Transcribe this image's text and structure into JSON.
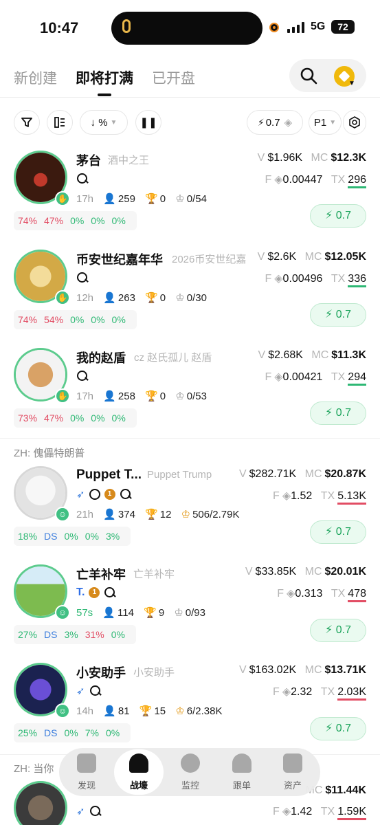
{
  "status": {
    "time": "10:47",
    "network": "5G",
    "battery": "72"
  },
  "header": {
    "tabs": [
      {
        "label": "新创建"
      },
      {
        "label": "即将打满"
      },
      {
        "label": "已开盘"
      }
    ]
  },
  "toolbar": {
    "sort_label": "%",
    "quick_buy": "0.7",
    "preset": "P1"
  },
  "rows": [
    {
      "name": "茅台",
      "subtitle": "酒中之王",
      "age": "17h",
      "holders": "259",
      "trophy": "0",
      "crown": "0/54",
      "v": "$1.96K",
      "mc": "$12.3K",
      "f": "0.00447",
      "tx": "296",
      "pct1": "74%",
      "pct2": "47%",
      "pct3": "0%",
      "pct4": "0%",
      "pct5": "0%",
      "buy": "0.7"
    },
    {
      "name": "币安世纪嘉年华",
      "subtitle": "2026币安世纪嘉",
      "age": "12h",
      "holders": "263",
      "trophy": "0",
      "crown": "0/30",
      "v": "$2.6K",
      "mc": "$12.05K",
      "f": "0.00496",
      "tx": "336",
      "pct1": "74%",
      "pct2": "54%",
      "pct3": "0%",
      "pct4": "0%",
      "pct5": "0%",
      "buy": "0.7"
    },
    {
      "name": "我的赵盾",
      "subtitle": "cz 赵氏孤儿 赵盾",
      "age": "17h",
      "holders": "258",
      "trophy": "0",
      "crown": "0/53",
      "v": "$2.68K",
      "mc": "$11.3K",
      "f": "0.00421",
      "tx": "294",
      "pct1": "73%",
      "pct2": "47%",
      "pct3": "0%",
      "pct4": "0%",
      "pct5": "0%",
      "buy": "0.7"
    },
    {
      "group": "ZH: 傀儡特朗普",
      "name": "Puppet T...",
      "subtitle": "Puppet Trump",
      "age": "21h",
      "holders": "374",
      "trophy": "12",
      "crown": "506/2.79K",
      "v": "$282.71K",
      "mc": "$20.87K",
      "f": "1.52",
      "tx": "5.13K",
      "pct1": "18%",
      "pct2": "DS",
      "pct3": "0%",
      "pct4": "0%",
      "pct5": "3%",
      "buy": "0.7"
    },
    {
      "name": "亡羊补牢",
      "subtitle": "亡羊补牢",
      "age": "57s",
      "holders": "114",
      "trophy": "9",
      "crown": "0/93",
      "v": "$33.85K",
      "mc": "$20.01K",
      "f": "0.313",
      "tx": "478",
      "pct1": "27%",
      "pct2": "DS",
      "pct3": "3%",
      "pct4": "31%",
      "pct5": "0%",
      "buy": "0.7"
    },
    {
      "name": "小安助手",
      "subtitle": "小安助手",
      "age": "14h",
      "holders": "81",
      "trophy": "15",
      "crown": "6/2.38K",
      "v": "$163.02K",
      "mc": "$13.71K",
      "f": "2.32",
      "tx": "2.03K",
      "pct1": "25%",
      "pct2": "DS",
      "pct3": "0%",
      "pct4": "7%",
      "pct5": "0%",
      "buy": "0.7"
    },
    {
      "group": "ZH: 当你",
      "mc": "$11.44K",
      "f": "1.42",
      "tx": "1.59K"
    }
  ],
  "labels": {
    "v": "V",
    "mc": "MC",
    "f": "F",
    "tx": "TX"
  },
  "nav": [
    {
      "label": "发现"
    },
    {
      "label": "战壕"
    },
    {
      "label": "监控"
    },
    {
      "label": "跟单"
    },
    {
      "label": "资产"
    }
  ],
  "colors": {
    "accent_green": "#2eb874",
    "red": "#e24d64",
    "blue": "#3b7ddd",
    "bnb": "#f0b90b"
  }
}
